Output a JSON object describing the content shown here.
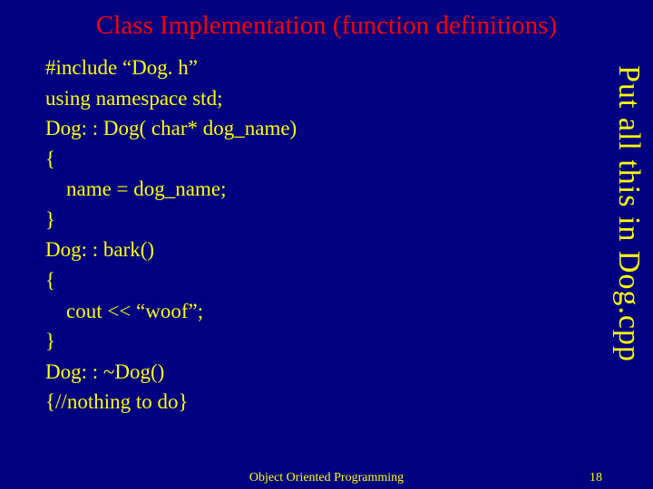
{
  "title": "Class Implementation (function definitions)",
  "code": {
    "lines": [
      "#include “Dog. h”",
      "using namespace std;",
      "Dog: : Dog( char* dog_name)",
      "{",
      "    name = dog_name;",
      "}",
      "Dog: : bark()",
      "{",
      "    cout << “woof”;",
      "}",
      "Dog: : ~Dog()",
      "{//nothing to do}"
    ]
  },
  "sideNote": "Put all this in Dog.cpp",
  "footer": {
    "center": "Object Oriented Programming",
    "pageNumber": "18"
  }
}
